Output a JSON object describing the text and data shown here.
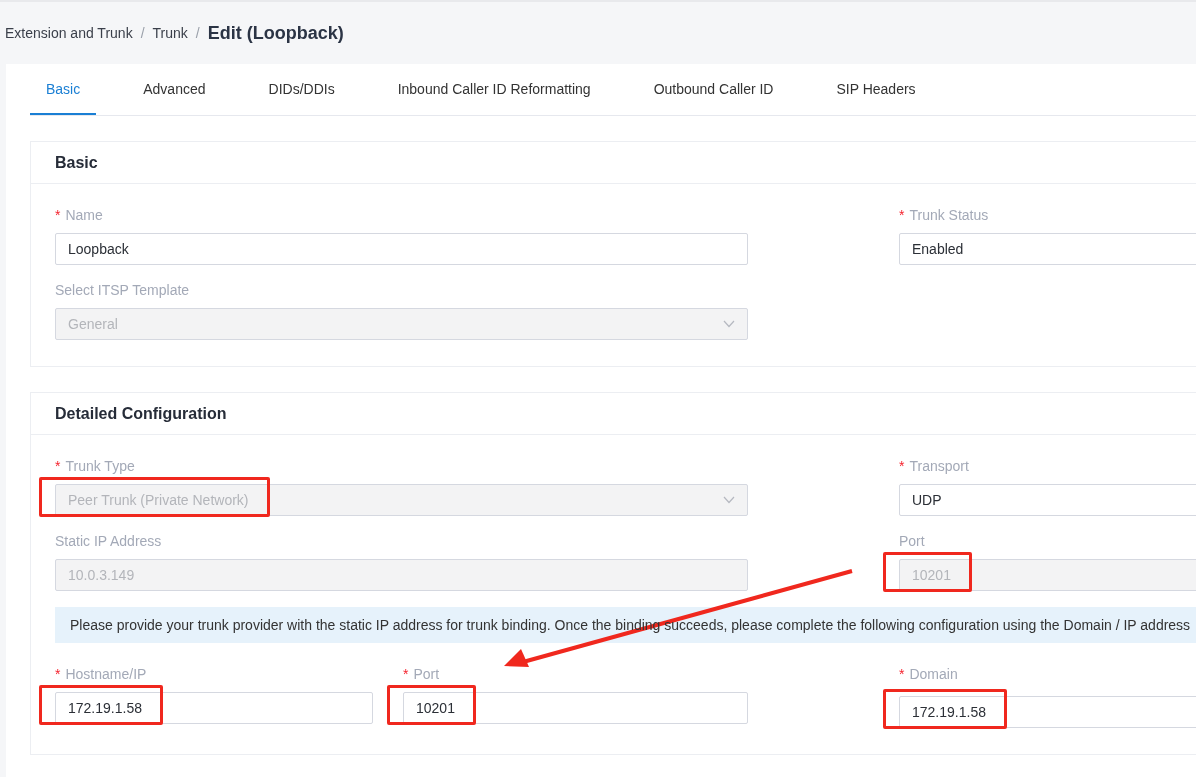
{
  "breadcrumb": [
    {
      "label": "Extension and Trunk",
      "separator": "/"
    },
    {
      "label": "Trunk",
      "separator": "/"
    }
  ],
  "page_title": "Edit (Loopback)",
  "tabs": [
    {
      "label": "Basic",
      "selected": true
    },
    {
      "label": "Advanced",
      "selected": false
    },
    {
      "label": "DIDs/DDIs",
      "selected": false
    },
    {
      "label": "Inbound Caller ID Reformatting",
      "selected": false
    },
    {
      "label": "Outbound Caller ID",
      "selected": false
    },
    {
      "label": "SIP Headers",
      "selected": false
    }
  ],
  "sections": [
    {
      "title": "Basic",
      "rows": [
        [
          {
            "required_mark": "*",
            "label": "Name",
            "value": "Loopback",
            "disabled": false
          },
          {
            "required_mark": "*",
            "label": "Trunk Status",
            "value": "Enabled",
            "disabled": false
          }
        ],
        [
          {
            "label": "Select ITSP Template",
            "kind": "select",
            "value": "General",
            "disabled": true
          }
        ]
      ]
    },
    {
      "title": "Detailed Configuration",
      "rows": [
        [
          {
            "required_mark": "*",
            "label": "Trunk Type",
            "kind": "select",
            "value": "Peer Trunk (Private Network)",
            "disabled": true,
            "highlighted": true
          },
          {
            "required_mark": "*",
            "label": "Transport",
            "value": "UDP",
            "disabled": false
          }
        ],
        [
          {
            "label": "Static IP Address",
            "value": "10.0.3.149",
            "disabled": true
          },
          {
            "label": "Port",
            "value": "10201",
            "disabled": true,
            "highlighted": true
          }
        ]
      ],
      "notice": "Please provide your trunk provider with the static IP address for trunk binding. Once the binding succeeds, please complete the following configuration using the Domain / IP address",
      "split_row": [
        {
          "required_mark": "*",
          "label": "Hostname/IP",
          "value": "172.19.1.58",
          "disabled": false,
          "highlighted": true
        },
        {
          "required_mark": "*",
          "label": "Port",
          "value": "10201",
          "disabled": false,
          "highlighted": true
        }
      ],
      "right_field": {
        "required_mark": "*",
        "label": "Domain",
        "value": "172.19.1.58",
        "disabled": false,
        "highlighted": true
      }
    }
  ],
  "annotation_arrow": true
}
